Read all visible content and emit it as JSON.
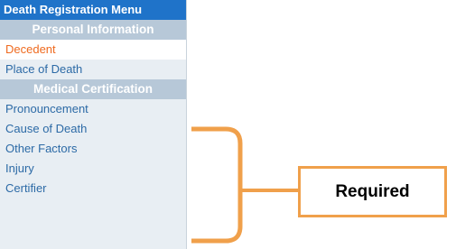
{
  "menu": {
    "title": "Death Registration Menu",
    "sections": [
      {
        "header": "Personal Information",
        "items": [
          {
            "label": "Decedent",
            "active": true
          },
          {
            "label": "Place of Death",
            "active": false
          }
        ]
      },
      {
        "header": "Medical Certification",
        "items": [
          {
            "label": "Pronouncement",
            "active": false
          },
          {
            "label": "Cause of Death",
            "active": false
          },
          {
            "label": "Other Factors",
            "active": false
          },
          {
            "label": "Injury",
            "active": false
          },
          {
            "label": "Certifier",
            "active": false
          }
        ]
      }
    ]
  },
  "annotation": {
    "label": "Required",
    "color": "#f0a04b"
  },
  "colors": {
    "title_bar": "#1f73c9",
    "section_header": "#b7c8d8",
    "menu_bg": "#e8eef3",
    "link": "#2c6aa6",
    "active_link": "#ef6a1f"
  }
}
